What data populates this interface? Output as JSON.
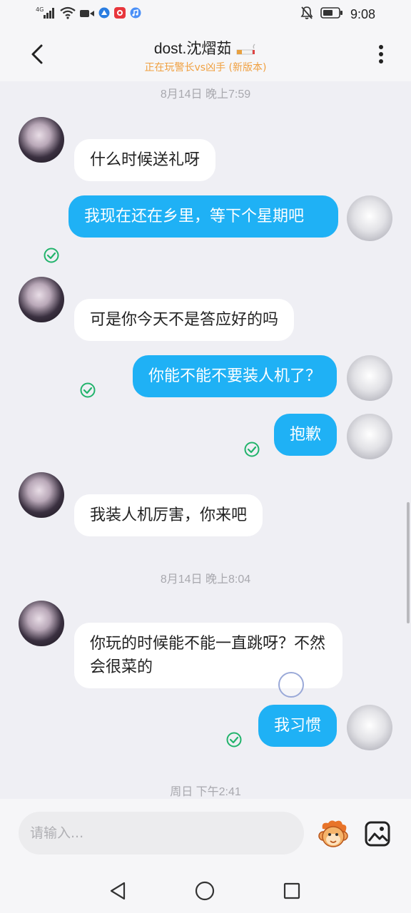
{
  "status_bar": {
    "network": "4G",
    "time": "9:08"
  },
  "header": {
    "title": "dost.沈熠茹",
    "subtitle": "正在玩警长vs凶手 (新版本)",
    "back_icon": "chevron-left-icon",
    "more_icon": "more-vertical-icon"
  },
  "messages": [
    {
      "type": "timestamp",
      "text": "8月14日 晚上7:59"
    },
    {
      "type": "received",
      "text": "什么时候送礼呀"
    },
    {
      "type": "sent",
      "text": "我现在还在乡里，等下个星期吧",
      "read": true
    },
    {
      "type": "received",
      "text": "可是你今天不是答应好的吗"
    },
    {
      "type": "sent",
      "text": "你能不能不要装人机了？",
      "read": true
    },
    {
      "type": "sent",
      "text": "抱歉",
      "read": true
    },
    {
      "type": "received",
      "text": "我装人机厉害，你来吧"
    },
    {
      "type": "timestamp",
      "text": "8月14日 晚上8:04"
    },
    {
      "type": "received",
      "text": "你玩的时候能不能一直跳呀？不然会很菜的"
    },
    {
      "type": "sent",
      "text": "我习惯",
      "read": true
    },
    {
      "type": "timestamp",
      "text": "周日 下午2:41"
    }
  ],
  "input": {
    "placeholder": "请输入..."
  },
  "colors": {
    "sent_bubble": "#1fb1f5",
    "received_bubble": "#ffffff",
    "background": "#efeff4",
    "read_check": "#21b36b",
    "subtitle": "#f0a040"
  }
}
